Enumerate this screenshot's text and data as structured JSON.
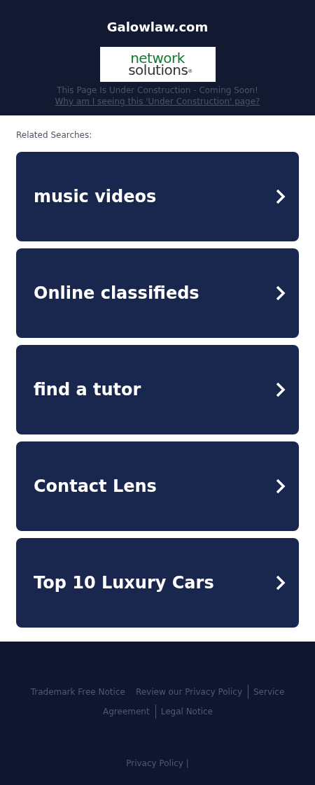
{
  "header": {
    "title": "Galowlaw.com",
    "logo": {
      "line_1": "network",
      "line_2": "solutions",
      "mark": "®"
    },
    "notice": "This Page Is Under Construction - Coming Soon!",
    "why_link": "Why am I seeing this 'Under Construction' page?"
  },
  "related": {
    "heading": "Related Searches:",
    "items": [
      {
        "label": "music videos"
      },
      {
        "label": "Online classifieds"
      },
      {
        "label": "find a tutor"
      },
      {
        "label": "Contact Lens"
      },
      {
        "label": "Top 10 Luxury Cars"
      }
    ]
  },
  "footer": {
    "link_rows": [
      [
        {
          "label": "Trademark Free Notice",
          "separator": false
        },
        {
          "label": "Review our Privacy Policy",
          "separator": true
        },
        {
          "label": "Service",
          "separator": false
        }
      ],
      [
        {
          "label": "Agreement",
          "separator": true
        },
        {
          "label": "Legal Notice",
          "separator": false
        }
      ]
    ],
    "privacy": "Privacy Policy |"
  }
}
